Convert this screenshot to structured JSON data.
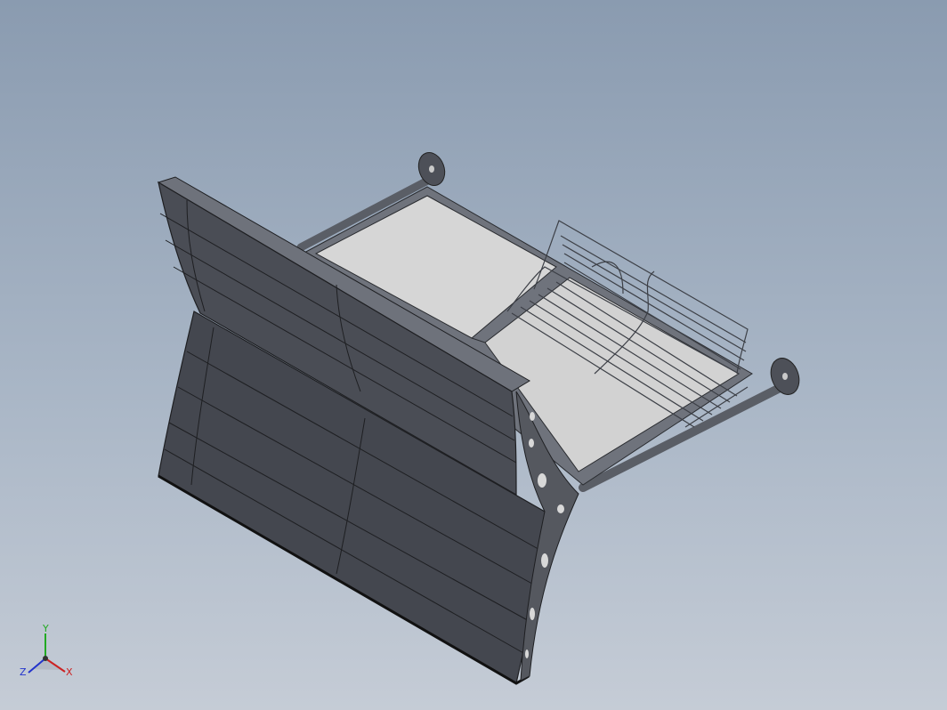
{
  "viewport": {
    "background_top": "#8a9bb0",
    "background_bottom": "#c5ccd6"
  },
  "model": {
    "panel_color": "#4a4d55",
    "frame_color": "#6f737c",
    "glass_color": "#d8d8d8",
    "edge_color": "#2a2c30"
  },
  "triad": {
    "x_label": "X",
    "y_label": "Y",
    "z_label": "Z",
    "x_color": "#cc2222",
    "y_color": "#22aa22",
    "z_color": "#2233cc"
  }
}
